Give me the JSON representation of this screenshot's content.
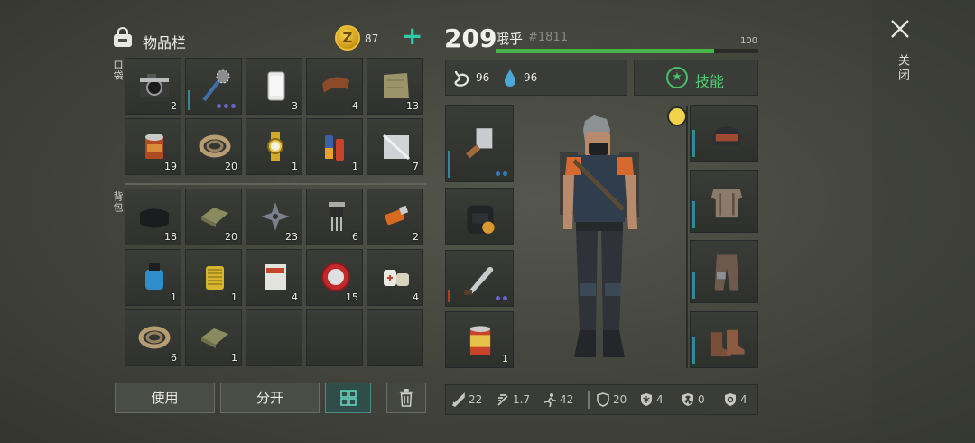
{
  "inventory": {
    "title": "物品栏",
    "coins": "87",
    "pocket_label": "口袋",
    "backpack_label": "背包",
    "pocket_items": [
      {
        "icon": "camera-icon",
        "count": "2"
      },
      {
        "icon": "spiked-club-icon",
        "count": ""
      },
      {
        "icon": "smartphone-icon",
        "count": "3"
      },
      {
        "icon": "leather-icon",
        "count": "4"
      },
      {
        "icon": "cloth-icon",
        "count": "13"
      },
      {
        "icon": "tin-can-icon",
        "count": "19"
      },
      {
        "icon": "rope-icon",
        "count": "20"
      },
      {
        "icon": "wristwatch-icon",
        "count": "1"
      },
      {
        "icon": "batteries-icon",
        "count": "1"
      },
      {
        "icon": "metal-plate-icon",
        "count": "7"
      }
    ],
    "backpack_items": [
      {
        "icon": "black-cloth-icon",
        "count": "18"
      },
      {
        "icon": "fabric-icon",
        "count": "20"
      },
      {
        "icon": "shuriken-icon",
        "count": "23"
      },
      {
        "icon": "transistor-icon",
        "count": "6"
      },
      {
        "icon": "usb-drive-icon",
        "count": "2"
      },
      {
        "icon": "water-pump-icon",
        "count": "1"
      },
      {
        "icon": "filter-icon",
        "count": "1"
      },
      {
        "icon": "asbestos-bag-icon",
        "count": "4"
      },
      {
        "icon": "bottle-cap-icon",
        "count": "15"
      },
      {
        "icon": "bandage-icon",
        "count": "4"
      },
      {
        "icon": "rope-icon",
        "count": "6"
      },
      {
        "icon": "fabric-icon",
        "count": "1"
      },
      {
        "icon": "",
        "count": ""
      },
      {
        "icon": "",
        "count": ""
      },
      {
        "icon": "",
        "count": ""
      }
    ],
    "buttons": {
      "use": "使用",
      "split": "分开"
    }
  },
  "character": {
    "level": "209",
    "name": "哦乎",
    "id": "#1811",
    "hp_max": "100",
    "hp_fraction": 0.83,
    "food": "96",
    "water": "96",
    "skills_label": "技能",
    "weapons": [
      {
        "icon": "cleaver-icon",
        "count": ""
      },
      {
        "icon": "backpack-icon",
        "count": ""
      },
      {
        "icon": "machete-icon",
        "count": ""
      },
      {
        "icon": "canned-food-icon",
        "count": "1"
      }
    ],
    "armor": [
      {
        "icon": "helmet-icon"
      },
      {
        "icon": "body-armor-icon"
      },
      {
        "icon": "armored-pants-icon"
      },
      {
        "icon": "boots-icon"
      }
    ],
    "stats": {
      "damage": "22",
      "attack_speed": "1.7",
      "move_speed": "42",
      "defense": "20",
      "cold": "4",
      "radiation": "0",
      "bio": "4"
    }
  },
  "close_label": "关闭",
  "colors": {
    "accent": "#2fc9a7",
    "hp": "#46b64a",
    "skill": "#4fcf72"
  }
}
